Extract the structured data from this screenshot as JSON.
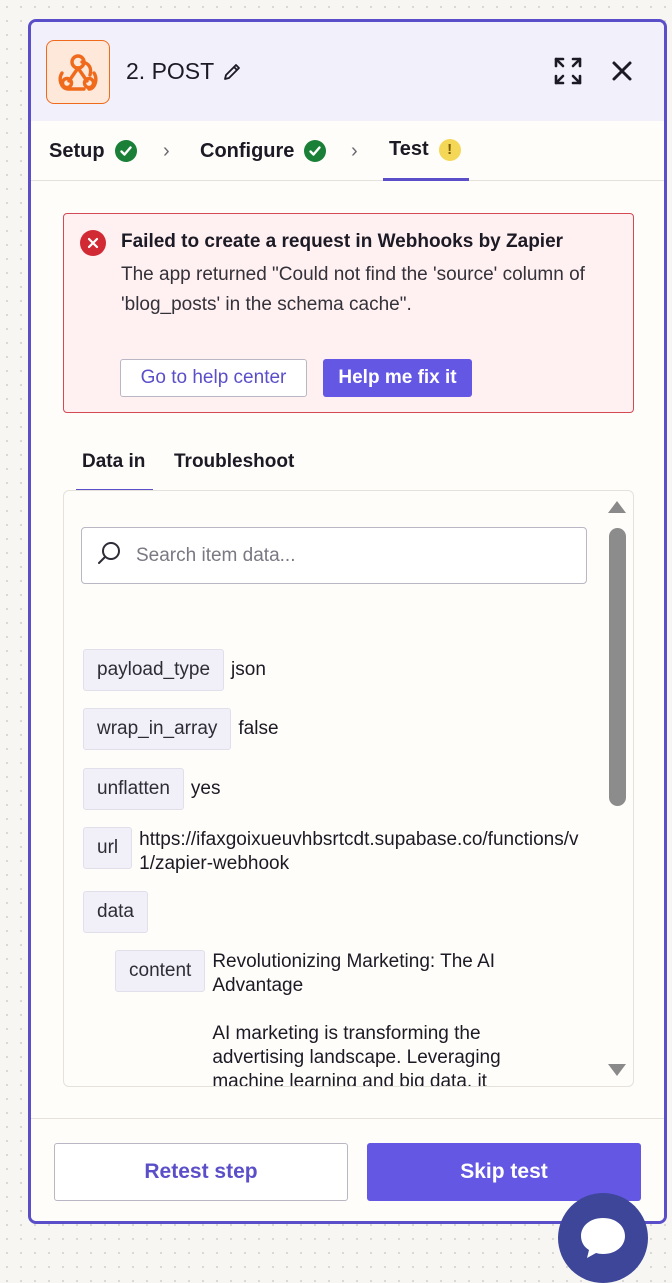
{
  "header": {
    "step_title": "2. POST",
    "app_icon": "webhook-icon",
    "edit_icon": "pencil-icon",
    "expand_icon": "expand-icon",
    "close_icon": "close-icon",
    "brand_color": "#f06a1b",
    "accent_color": "#5b4fc9"
  },
  "tabs": [
    {
      "label": "Setup",
      "status": "complete"
    },
    {
      "label": "Configure",
      "status": "complete"
    },
    {
      "label": "Test",
      "status": "warning",
      "active": true
    }
  ],
  "error": {
    "title": "Failed to create a request in Webhooks by Zapier",
    "message": "The app returned \"Could not find the 'source' column of 'blog_posts' in the schema cache\".",
    "help_button": "Go to help center",
    "fix_button": "Help me fix it",
    "color": "#d12a35"
  },
  "subtabs": {
    "data_in": "Data in",
    "troubleshoot": "Troubleshoot"
  },
  "search": {
    "placeholder": "Search item data..."
  },
  "fields": {
    "payload_type": {
      "key": "payload_type",
      "value": "json"
    },
    "wrap_in_array": {
      "key": "wrap_in_array",
      "value": "false"
    },
    "unflatten": {
      "key": "unflatten",
      "value": "yes"
    },
    "url": {
      "key": "url",
      "value": "https://ifaxgoixueuvhbsrtcdt.supabase.co/functions/v1/zapier-webhook"
    },
    "data": {
      "key": "data"
    },
    "content": {
      "key": "content",
      "line1": "Revolutionizing Marketing: The AI Advantage",
      "line2": "AI marketing is transforming the advertising landscape. Leveraging machine learning and big data, it"
    }
  },
  "footer": {
    "retest_button": "Retest step",
    "skip_button": "Skip test"
  },
  "chat_icon": "chat-bubble-icon"
}
